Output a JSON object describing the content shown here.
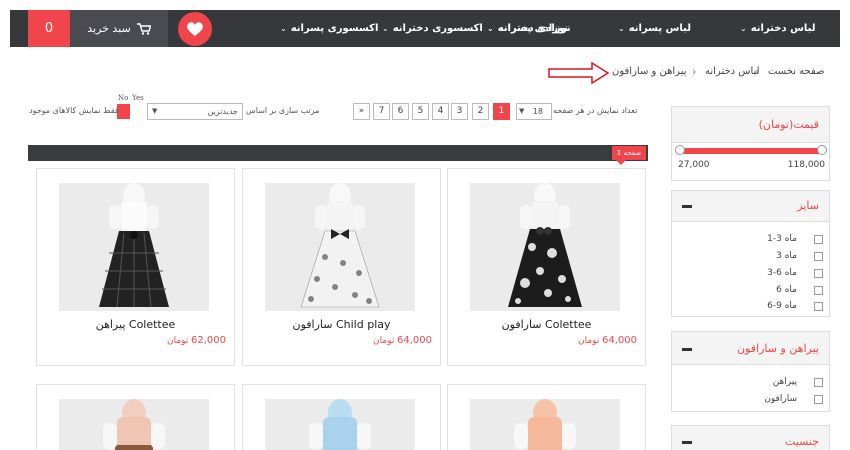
{
  "nav": {
    "items": [
      "لباس دخترانه",
      "لباس پسرانه",
      "نوزادی دخترانه",
      "نوزادی پسرانه",
      "اکسسوری دخترانه",
      "اکسسوری پسرانه"
    ],
    "cart_label": "سبد خرید",
    "cart_count": "0",
    "icons": [
      "cart-icon",
      "heart-icon",
      "chevron-down-icon"
    ]
  },
  "breadcrumb": [
    "صفحه نخست",
    "لباس دخترانه",
    "پیراهن و سارافون"
  ],
  "toolbar": {
    "per_page_label": "تعداد نمایش در هر صفحه",
    "per_page_value": "18",
    "pages": [
      "1",
      "2",
      "3",
      "4",
      "5",
      "6",
      "7",
      "»"
    ],
    "sort_label": "مرتب سازی بر اساس",
    "sort_value": "جدیدترین",
    "stock_label": "فقط نمایش کالاهای موجود",
    "toggle_no": "No",
    "toggle_yes": "Yes"
  },
  "page_badge": "صفحه 1",
  "products": [
    {
      "name": "سارافون Colettee",
      "price": "64,000",
      "currency": "تومان"
    },
    {
      "name": "سارافون Child play",
      "price": "64,000",
      "currency": "تومان"
    },
    {
      "name": "پیراهن Colettee",
      "price": "62,000",
      "currency": "تومان"
    }
  ],
  "filters": {
    "price": {
      "title": "قیمت(تومان)",
      "min": "27,000",
      "max": "118,000"
    },
    "size": {
      "title": "سایز",
      "options": [
        "1-3 ماه",
        "3 ماه",
        "3-6 ماه",
        "6 ماه",
        "6-9 ماه"
      ]
    },
    "category": {
      "title": "پیراهن و سارافون",
      "options": [
        "پیراهن",
        "سارافون"
      ]
    },
    "gender": {
      "title": "جنسیت"
    }
  },
  "colors": {
    "accent": "#f0464b",
    "nav_bg": "#37383c"
  }
}
